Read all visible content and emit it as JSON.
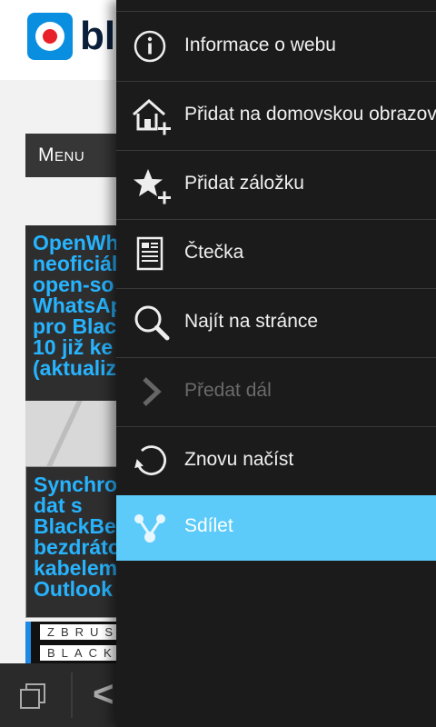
{
  "background_page": {
    "logo_text": "bl",
    "menu_label": "Menu",
    "articles": [
      {
        "title": "OpenWh\nneoficiál\nopen-so\nWhatsAp\npro Blac\n10 již ke\n(aktualiz"
      },
      {
        "title": "Synchro\ndat s\nBlackBe\nbezdráto\nkabelem\nOutlook"
      }
    ],
    "ad": {
      "line_1": "ZBRUSU",
      "line_2": "BLACKB"
    }
  },
  "bottom_bar": {
    "tabs_icon": "tabs-icon",
    "back_icon": "chevron-left-icon",
    "back_glyph": "<"
  },
  "menu": {
    "items": [
      {
        "label": "Informace o webu",
        "icon": "info-icon",
        "state": "normal"
      },
      {
        "label": "Přidat na domovskou obrazovku",
        "icon": "home-add-icon",
        "state": "normal"
      },
      {
        "label": "Přidat záložku",
        "icon": "star-add-icon",
        "state": "normal"
      },
      {
        "label": "Čtečka",
        "icon": "reader-icon",
        "state": "normal"
      },
      {
        "label": "Najít na stránce",
        "icon": "search-icon",
        "state": "normal"
      },
      {
        "label": "Předat dál",
        "icon": "forward-icon",
        "state": "disabled"
      },
      {
        "label": "Znovu načíst",
        "icon": "refresh-icon",
        "state": "normal"
      },
      {
        "label": "Sdílet",
        "icon": "share-icon",
        "state": "highlighted"
      }
    ]
  },
  "colors": {
    "highlight": "#5ccbf9",
    "link_blue": "#27b4ff",
    "panel": "#1b1b1b"
  }
}
